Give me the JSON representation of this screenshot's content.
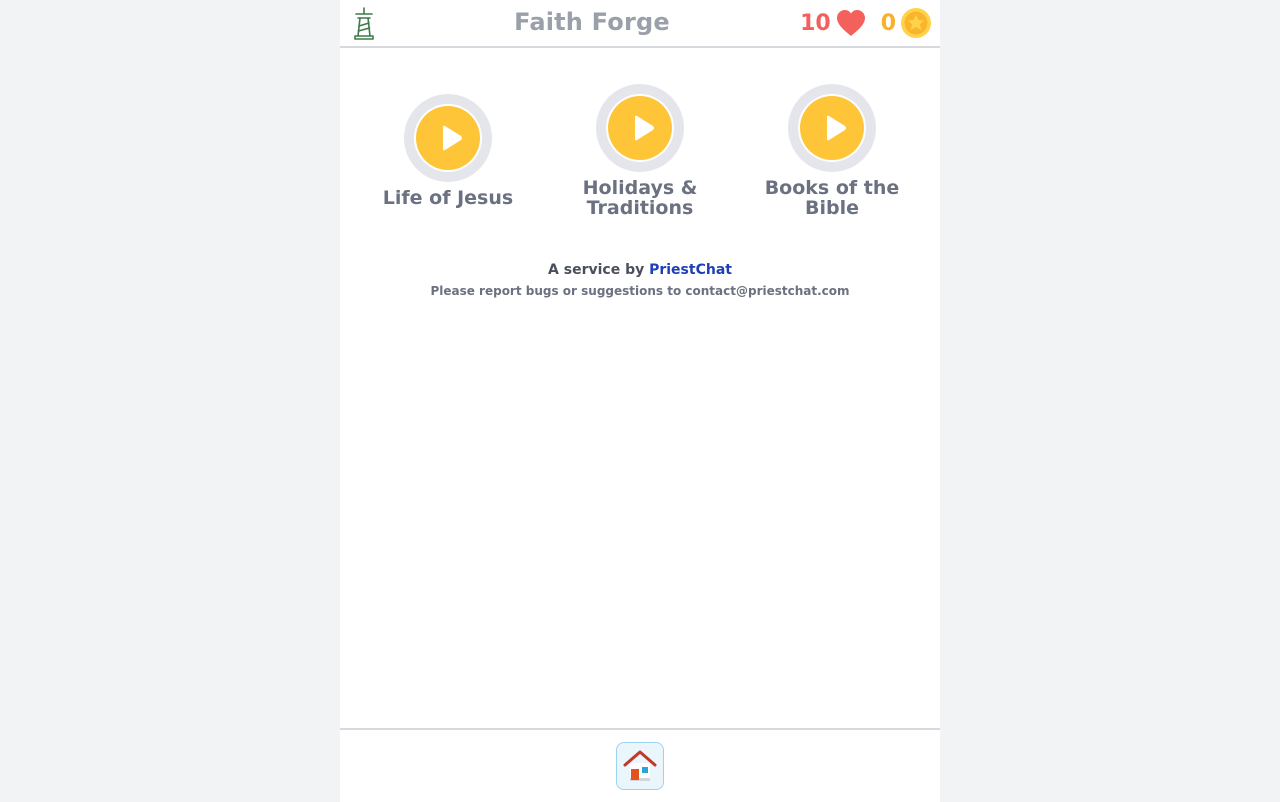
{
  "header": {
    "title": "Faith Forge",
    "hearts": "10",
    "coins": "0",
    "logo_icon": "cross-lighthouse-icon",
    "heart_icon": "heart-icon",
    "coin_icon": "star-coin-icon"
  },
  "lessons": [
    {
      "label": "Life of Jesus",
      "icon": "play-icon"
    },
    {
      "label": "Holidays & Traditions",
      "icon": "play-icon"
    },
    {
      "label": "Books of the Bible",
      "icon": "play-icon"
    }
  ],
  "footer": {
    "service_prefix": "A service by",
    "service_brand": "PriestChat",
    "report_text": "Please report bugs or suggestions to contact@priestchat.com"
  },
  "nav": {
    "home_icon": "home-icon"
  },
  "colors": {
    "accent_yellow": "#ffc538",
    "heart_red": "#f4615c",
    "coin_orange": "#fab12a",
    "brand_blue": "#1f3fb5"
  }
}
